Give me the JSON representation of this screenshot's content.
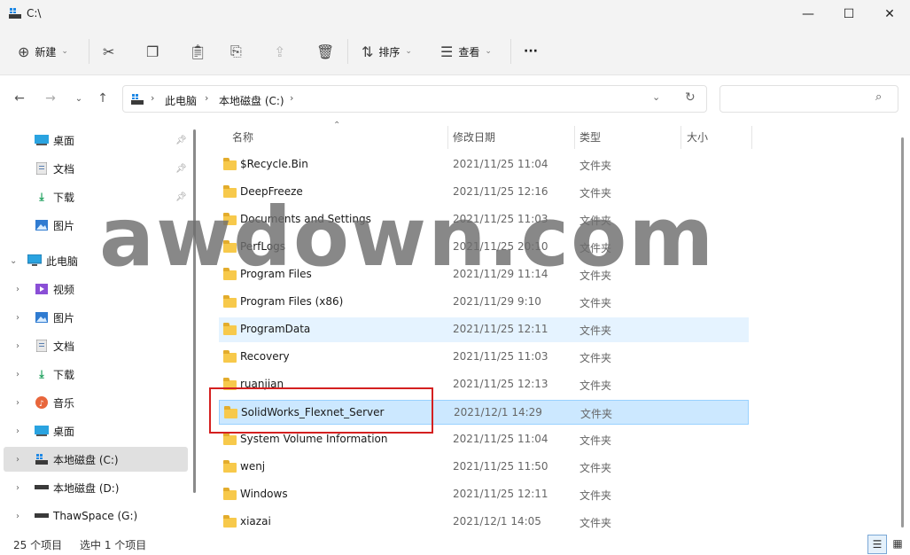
{
  "window": {
    "title": "C:\\",
    "minimize": "—",
    "maximize": "☐",
    "close": "✕"
  },
  "toolbar": {
    "new_label": "新建",
    "sort_label": "排序",
    "view_label": "查看",
    "more_label": "···"
  },
  "address": {
    "segments": [
      "此电脑",
      "本地磁盘 (C:)"
    ],
    "search_placeholder": ""
  },
  "nav": {
    "quick": [
      {
        "label": "桌面",
        "icon": "desktop-icon",
        "pinned": true
      },
      {
        "label": "文档",
        "icon": "documents-icon",
        "pinned": true
      },
      {
        "label": "下载",
        "icon": "downloads-icon",
        "pinned": true
      },
      {
        "label": "图片",
        "icon": "pictures-icon",
        "pinned": false
      }
    ],
    "this_pc": "此电脑",
    "pc_items": [
      {
        "label": "视频",
        "icon": "videos-icon"
      },
      {
        "label": "图片",
        "icon": "pictures-icon"
      },
      {
        "label": "文档",
        "icon": "documents-icon"
      },
      {
        "label": "下载",
        "icon": "downloads-icon"
      },
      {
        "label": "音乐",
        "icon": "music-icon"
      },
      {
        "label": "桌面",
        "icon": "desktop-icon"
      },
      {
        "label": "本地磁盘 (C:)",
        "icon": "drive-c-icon",
        "selected": true
      },
      {
        "label": "本地磁盘 (D:)",
        "icon": "drive-icon"
      },
      {
        "label": "ThawSpace (G:)",
        "icon": "drive-icon"
      }
    ]
  },
  "columns": {
    "name": "名称",
    "date": "修改日期",
    "type": "类型",
    "size": "大小"
  },
  "files": [
    {
      "name": "$Recycle.Bin",
      "date": "2021/11/25 11:04",
      "type": "文件夹",
      "state": ""
    },
    {
      "name": "DeepFreeze",
      "date": "2021/11/25 12:16",
      "type": "文件夹",
      "state": ""
    },
    {
      "name": "Documents and Settings",
      "date": "2021/11/25 11:03",
      "type": "文件夹",
      "state": ""
    },
    {
      "name": "PerfLogs",
      "date": "2021/11/25 20:10",
      "type": "文件夹",
      "state": ""
    },
    {
      "name": "Program Files",
      "date": "2021/11/29 11:14",
      "type": "文件夹",
      "state": ""
    },
    {
      "name": "Program Files (x86)",
      "date": "2021/11/29 9:10",
      "type": "文件夹",
      "state": ""
    },
    {
      "name": "ProgramData",
      "date": "2021/11/25 12:11",
      "type": "文件夹",
      "state": "hover"
    },
    {
      "name": "Recovery",
      "date": "2021/11/25 11:03",
      "type": "文件夹",
      "state": ""
    },
    {
      "name": "ruanjian",
      "date": "2021/11/25 12:13",
      "type": "文件夹",
      "state": ""
    },
    {
      "name": "SolidWorks_Flexnet_Server",
      "date": "2021/12/1 14:29",
      "type": "文件夹",
      "state": "selected"
    },
    {
      "name": "System Volume Information",
      "date": "2021/11/25 11:04",
      "type": "文件夹",
      "state": ""
    },
    {
      "name": "wenj",
      "date": "2021/11/25 11:50",
      "type": "文件夹",
      "state": ""
    },
    {
      "name": "Windows",
      "date": "2021/11/25 12:11",
      "type": "文件夹",
      "state": ""
    },
    {
      "name": "xiazai",
      "date": "2021/12/1 14:05",
      "type": "文件夹",
      "state": ""
    }
  ],
  "status": {
    "count": "25 个项目",
    "selected": "选中 1 个项目"
  },
  "watermark": "awdown.com",
  "colors": {
    "selection": "#cce8ff",
    "hover": "#e5f3ff",
    "folder": "#f7c94b",
    "highlight_box": "#d42020"
  }
}
